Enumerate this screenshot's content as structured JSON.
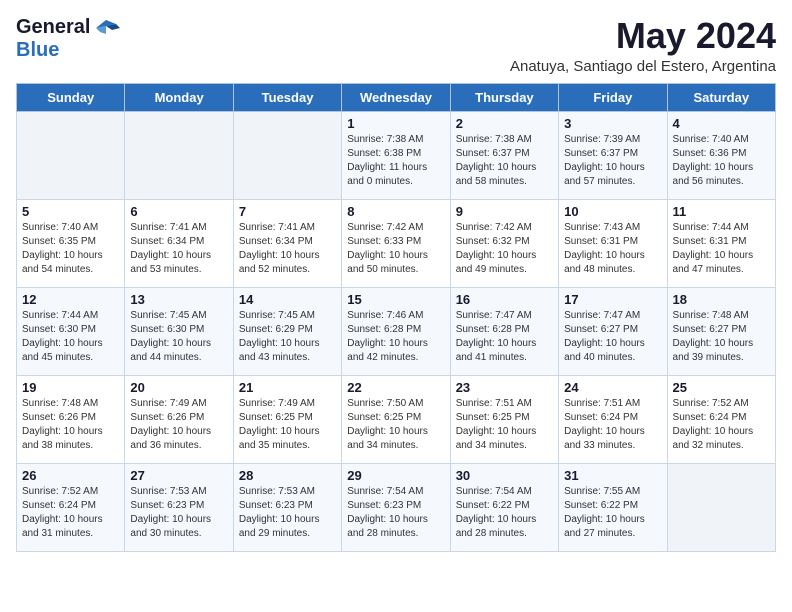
{
  "logo": {
    "general": "General",
    "blue": "Blue"
  },
  "title": {
    "month_year": "May 2024",
    "location": "Anatuya, Santiago del Estero, Argentina"
  },
  "days_of_week": [
    "Sunday",
    "Monday",
    "Tuesday",
    "Wednesday",
    "Thursday",
    "Friday",
    "Saturday"
  ],
  "weeks": [
    [
      {
        "day": "",
        "info": ""
      },
      {
        "day": "",
        "info": ""
      },
      {
        "day": "",
        "info": ""
      },
      {
        "day": "1",
        "info": "Sunrise: 7:38 AM\nSunset: 6:38 PM\nDaylight: 11 hours\nand 0 minutes."
      },
      {
        "day": "2",
        "info": "Sunrise: 7:38 AM\nSunset: 6:37 PM\nDaylight: 10 hours\nand 58 minutes."
      },
      {
        "day": "3",
        "info": "Sunrise: 7:39 AM\nSunset: 6:37 PM\nDaylight: 10 hours\nand 57 minutes."
      },
      {
        "day": "4",
        "info": "Sunrise: 7:40 AM\nSunset: 6:36 PM\nDaylight: 10 hours\nand 56 minutes."
      }
    ],
    [
      {
        "day": "5",
        "info": "Sunrise: 7:40 AM\nSunset: 6:35 PM\nDaylight: 10 hours\nand 54 minutes."
      },
      {
        "day": "6",
        "info": "Sunrise: 7:41 AM\nSunset: 6:34 PM\nDaylight: 10 hours\nand 53 minutes."
      },
      {
        "day": "7",
        "info": "Sunrise: 7:41 AM\nSunset: 6:34 PM\nDaylight: 10 hours\nand 52 minutes."
      },
      {
        "day": "8",
        "info": "Sunrise: 7:42 AM\nSunset: 6:33 PM\nDaylight: 10 hours\nand 50 minutes."
      },
      {
        "day": "9",
        "info": "Sunrise: 7:42 AM\nSunset: 6:32 PM\nDaylight: 10 hours\nand 49 minutes."
      },
      {
        "day": "10",
        "info": "Sunrise: 7:43 AM\nSunset: 6:31 PM\nDaylight: 10 hours\nand 48 minutes."
      },
      {
        "day": "11",
        "info": "Sunrise: 7:44 AM\nSunset: 6:31 PM\nDaylight: 10 hours\nand 47 minutes."
      }
    ],
    [
      {
        "day": "12",
        "info": "Sunrise: 7:44 AM\nSunset: 6:30 PM\nDaylight: 10 hours\nand 45 minutes."
      },
      {
        "day": "13",
        "info": "Sunrise: 7:45 AM\nSunset: 6:30 PM\nDaylight: 10 hours\nand 44 minutes."
      },
      {
        "day": "14",
        "info": "Sunrise: 7:45 AM\nSunset: 6:29 PM\nDaylight: 10 hours\nand 43 minutes."
      },
      {
        "day": "15",
        "info": "Sunrise: 7:46 AM\nSunset: 6:28 PM\nDaylight: 10 hours\nand 42 minutes."
      },
      {
        "day": "16",
        "info": "Sunrise: 7:47 AM\nSunset: 6:28 PM\nDaylight: 10 hours\nand 41 minutes."
      },
      {
        "day": "17",
        "info": "Sunrise: 7:47 AM\nSunset: 6:27 PM\nDaylight: 10 hours\nand 40 minutes."
      },
      {
        "day": "18",
        "info": "Sunrise: 7:48 AM\nSunset: 6:27 PM\nDaylight: 10 hours\nand 39 minutes."
      }
    ],
    [
      {
        "day": "19",
        "info": "Sunrise: 7:48 AM\nSunset: 6:26 PM\nDaylight: 10 hours\nand 38 minutes."
      },
      {
        "day": "20",
        "info": "Sunrise: 7:49 AM\nSunset: 6:26 PM\nDaylight: 10 hours\nand 36 minutes."
      },
      {
        "day": "21",
        "info": "Sunrise: 7:49 AM\nSunset: 6:25 PM\nDaylight: 10 hours\nand 35 minutes."
      },
      {
        "day": "22",
        "info": "Sunrise: 7:50 AM\nSunset: 6:25 PM\nDaylight: 10 hours\nand 34 minutes."
      },
      {
        "day": "23",
        "info": "Sunrise: 7:51 AM\nSunset: 6:25 PM\nDaylight: 10 hours\nand 34 minutes."
      },
      {
        "day": "24",
        "info": "Sunrise: 7:51 AM\nSunset: 6:24 PM\nDaylight: 10 hours\nand 33 minutes."
      },
      {
        "day": "25",
        "info": "Sunrise: 7:52 AM\nSunset: 6:24 PM\nDaylight: 10 hours\nand 32 minutes."
      }
    ],
    [
      {
        "day": "26",
        "info": "Sunrise: 7:52 AM\nSunset: 6:24 PM\nDaylight: 10 hours\nand 31 minutes."
      },
      {
        "day": "27",
        "info": "Sunrise: 7:53 AM\nSunset: 6:23 PM\nDaylight: 10 hours\nand 30 minutes."
      },
      {
        "day": "28",
        "info": "Sunrise: 7:53 AM\nSunset: 6:23 PM\nDaylight: 10 hours\nand 29 minutes."
      },
      {
        "day": "29",
        "info": "Sunrise: 7:54 AM\nSunset: 6:23 PM\nDaylight: 10 hours\nand 28 minutes."
      },
      {
        "day": "30",
        "info": "Sunrise: 7:54 AM\nSunset: 6:22 PM\nDaylight: 10 hours\nand 28 minutes."
      },
      {
        "day": "31",
        "info": "Sunrise: 7:55 AM\nSunset: 6:22 PM\nDaylight: 10 hours\nand 27 minutes."
      },
      {
        "day": "",
        "info": ""
      }
    ]
  ]
}
